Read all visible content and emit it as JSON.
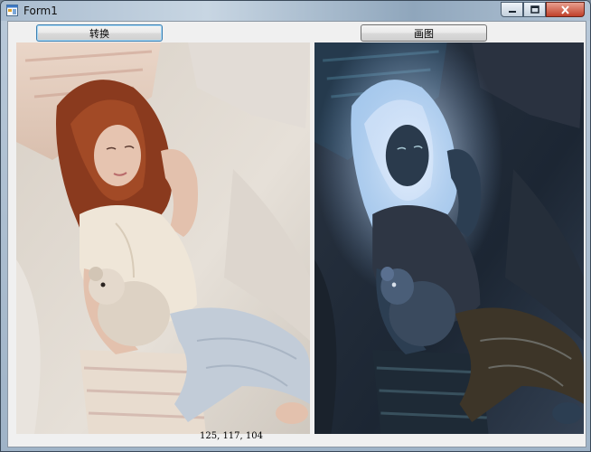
{
  "window": {
    "title": "Form1",
    "controls": {
      "minimize_icon": "minimize-icon",
      "maximize_icon": "maximize-icon",
      "close_icon": "close-icon"
    }
  },
  "toolbar": {
    "convert_label": "转换",
    "draw_label": "画图"
  },
  "images": {
    "original": "photo of a red-haired girl lying on a bed with a teddy bear",
    "inverted": "color-inverted version of the same photo"
  },
  "status": {
    "pixel_rgb": "125, 117, 104"
  },
  "colors": {
    "client_bg": "#f0f0f0",
    "focus_border": "#3c7fb1"
  }
}
